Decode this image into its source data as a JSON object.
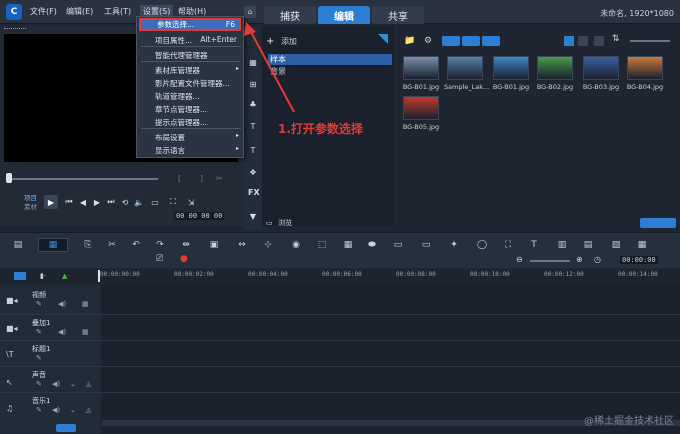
{
  "menubar": {
    "logo": "C",
    "items": [
      "文件(F)",
      "编辑(E)",
      "工具(T)",
      "设置(S)",
      "帮助(H)"
    ],
    "tabs": [
      "捕获",
      "编辑",
      "共享"
    ],
    "project_info": "未命名, 1920*1080"
  },
  "dropdown": {
    "items": [
      {
        "label": "参数选择...",
        "shortcut": "F6"
      },
      {
        "label": "项目属性...",
        "shortcut": "Alt+Enter"
      },
      {
        "label": "智能代理管理器",
        "shortcut": ""
      },
      {
        "label": "素材库管理器",
        "shortcut": ""
      },
      {
        "label": "影片配置文件管理器...",
        "shortcut": ""
      },
      {
        "label": "轨道管理器...",
        "shortcut": ""
      },
      {
        "label": "章节点管理器...",
        "shortcut": ""
      },
      {
        "label": "提示点管理器...",
        "shortcut": ""
      },
      {
        "label": "布局设置",
        "shortcut": ""
      },
      {
        "label": "显示语言",
        "shortcut": ""
      }
    ]
  },
  "preview": {
    "mode_project": "项目",
    "mode_clip": "素材",
    "timecode": "00 00 00 00"
  },
  "category": {
    "add_label": "添加",
    "items": [
      "样本",
      "背景"
    ],
    "browse_label": "浏览"
  },
  "library": {
    "thumbs": [
      {
        "label": "BG-B01.jpg",
        "color": "#7a8fa8"
      },
      {
        "label": "Sample_Lak...",
        "color": "#5b7fa6"
      },
      {
        "label": "BG-B01.jpg",
        "color": "#3d86c9"
      },
      {
        "label": "BG-B02.jpg",
        "color": "#4a9a48"
      },
      {
        "label": "BG-B03.jpg",
        "color": "#3a5fa0"
      },
      {
        "label": "BG-B04.jpg",
        "color": "#c97a3a"
      },
      {
        "label": "BG-B05.jpg",
        "color": "#c0392b"
      }
    ]
  },
  "annotation": "1.打开参数选择",
  "ruler": {
    "ticks": [
      "00:00:00:00",
      "00:00:02:00",
      "00:00:04:00",
      "00:00:06:00",
      "00:00:08:00",
      "00:00:10:00",
      "00:00:12:00",
      "00:00:14:00"
    ],
    "timecode": "00:00:00"
  },
  "tracks": [
    "视频",
    "叠加1",
    "标题1",
    "声音",
    "音乐1"
  ],
  "watermark": "@稀土掘金技术社区"
}
